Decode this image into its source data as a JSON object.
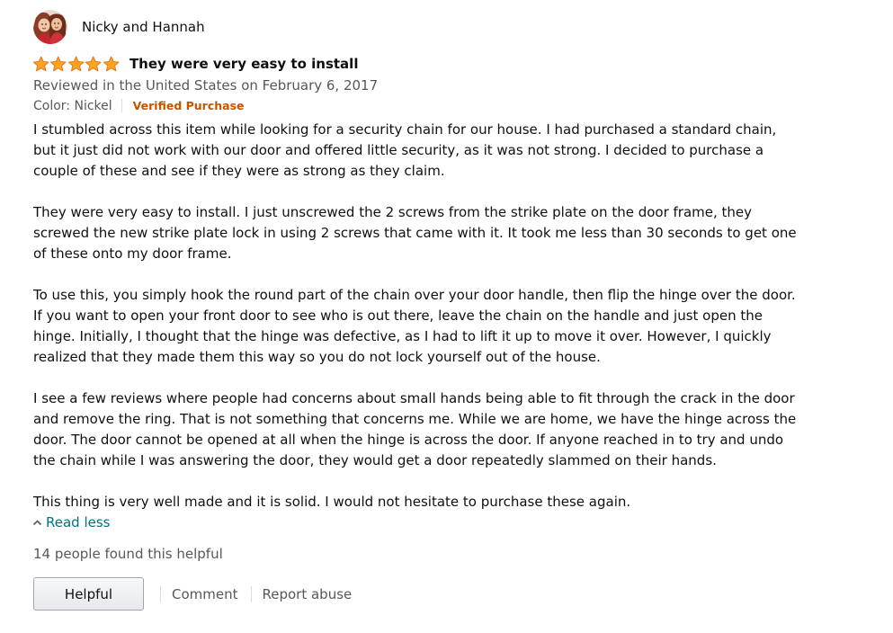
{
  "reviewer": {
    "name": "Nicky and Hannah"
  },
  "review": {
    "rating": 5,
    "rating_max": 5,
    "star_color": "#ffa41c",
    "title": "They were very easy to install",
    "reviewed_in": "Reviewed in the United States on February 6, 2017",
    "color_variant": "Color: Nickel",
    "verified": "Verified Purchase",
    "verified_color": "#c45500",
    "paragraphs": [
      "I stumbled across this item while looking for a security chain for our house. I had purchased a standard chain, but it just did not work with our door and offered little security, as it was not strong. I decided to purchase a couple of these and see if they were as strong as they claim.",
      "They were very easy to install. I just unscrewed the 2 screws from the strike plate on the door frame, they screwed the new strike plate lock in using 2 screws that came with it. It took me less than 30 seconds to get one of these onto my door frame.",
      "To use this, you simply hook the round part of the chain over your door handle, then flip the hinge over the door. If you want to open your front door to see who is out there, leave the chain on the handle and just open the hinge. Initially, I thought that the hinge was defective, as I had to lift it up to move it over. However, I quickly realized that they made them this way so you do not lock yourself out of the house.",
      "I see a few reviews where people had concerns about small hands being able to fit through the crack in the door and remove the ring. That is not something that concerns me. While we are home, we have the hinge across the door. The door cannot be opened at all when the hinge is across the door. If anyone reached in to try and undo the chain while I was answering the door, they would get a door repeatedly slammed on their hands.",
      "This thing is very well made and it is solid. I would not hesitate to purchase these again."
    ],
    "read_less": "Read less",
    "link_color": "#007185",
    "helpful_count": "14 people found this helpful"
  },
  "actions": {
    "helpful": "Helpful",
    "comment": "Comment",
    "report": "Report abuse"
  }
}
